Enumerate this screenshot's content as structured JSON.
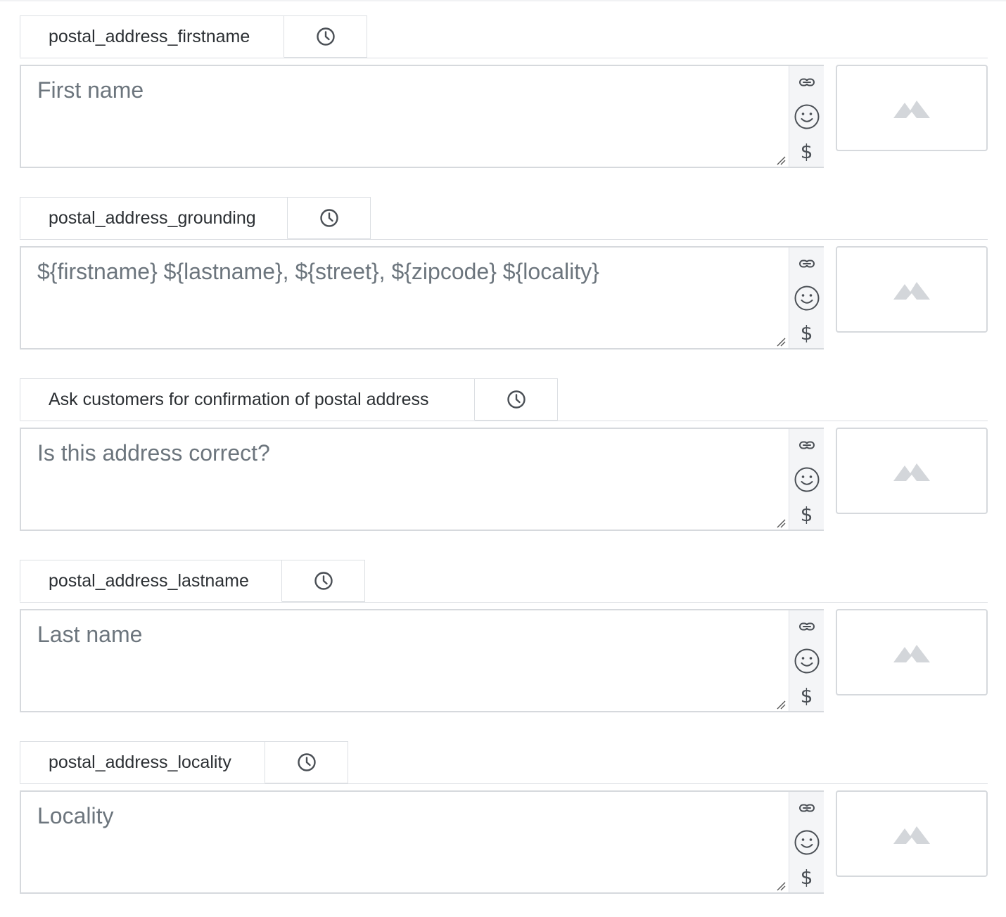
{
  "fields": [
    {
      "tab_label": "postal_address_firstname",
      "text": "First name",
      "icons": [
        "clock-icon",
        "link-icon",
        "emoji-icon",
        "dollar-icon",
        "image-placeholder-icon"
      ]
    },
    {
      "tab_label": "postal_address_grounding",
      "text": "${firstname} ${lastname}, ${street}, ${zipcode} ${locality}",
      "icons": [
        "clock-icon",
        "link-icon",
        "emoji-icon",
        "dollar-icon",
        "image-placeholder-icon"
      ]
    },
    {
      "tab_label": "Ask customers for confirmation of postal address",
      "text": "Is this address correct?",
      "icons": [
        "clock-icon",
        "link-icon",
        "emoji-icon",
        "dollar-icon",
        "image-placeholder-icon"
      ]
    },
    {
      "tab_label": "postal_address_lastname",
      "text": "Last name",
      "icons": [
        "clock-icon",
        "link-icon",
        "emoji-icon",
        "dollar-icon",
        "image-placeholder-icon"
      ]
    },
    {
      "tab_label": "postal_address_locality",
      "text": "Locality",
      "icons": [
        "clock-icon",
        "link-icon",
        "emoji-icon",
        "dollar-icon",
        "image-placeholder-icon"
      ]
    }
  ],
  "toolbar": {
    "dollar_symbol": "$"
  },
  "colors": {
    "border": "#d6d9dd",
    "text_muted": "#6c757d",
    "icon": "#4a4f55",
    "image_placeholder": "#d3d6da",
    "tools_background": "#f4f5f7"
  }
}
